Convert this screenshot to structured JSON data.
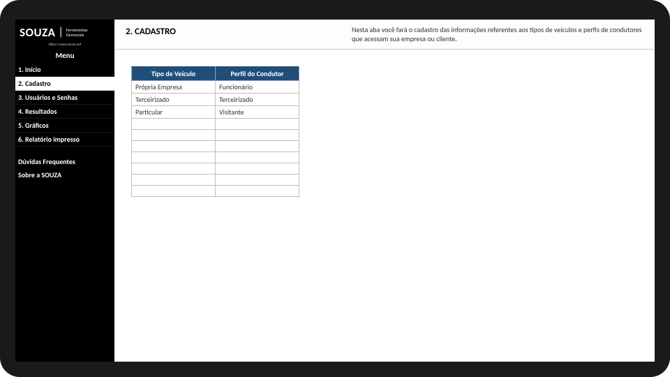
{
  "logo": {
    "main": "SOUZA",
    "sub": "Ferramentas\nGerenciais",
    "url": "https://www.souza.net"
  },
  "sidebar": {
    "menu_title": "Menu",
    "items": [
      {
        "label": "1. Início"
      },
      {
        "label": "2. Cadastro"
      },
      {
        "label": "3. Usuários e Senhas"
      },
      {
        "label": "4. Resultados"
      },
      {
        "label": "5. Gráficos"
      },
      {
        "label": "6. Relatório impresso"
      }
    ],
    "footer": [
      {
        "label": "Dúvidas Frequentes"
      },
      {
        "label": "Sobre a SOUZA"
      }
    ]
  },
  "header": {
    "title": "2. CADASTRO",
    "description": "Nesta aba você fará o cadastro das informações referentes aos tipos de veículos e perfis de condutores que acessam sua empresa ou cliente."
  },
  "table": {
    "headers": [
      "Tipo de Veículo",
      "Perfil do Condutor"
    ],
    "rows": [
      [
        "Própria Empresa",
        "Funcionário"
      ],
      [
        "Terceirizado",
        "Terceirizado"
      ],
      [
        "Particular",
        "Visitante"
      ],
      [
        "",
        ""
      ],
      [
        "",
        ""
      ],
      [
        "",
        ""
      ],
      [
        "",
        ""
      ],
      [
        "",
        ""
      ],
      [
        "",
        ""
      ],
      [
        "",
        ""
      ]
    ]
  }
}
